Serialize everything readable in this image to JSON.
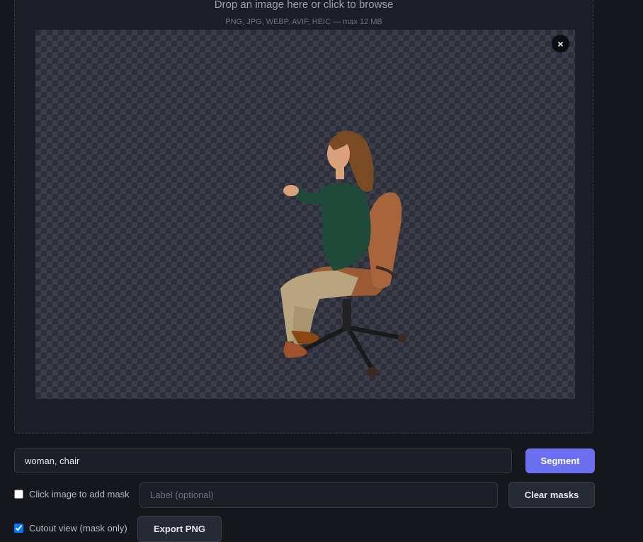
{
  "dropzone": {
    "title": "Drop an image here or click to browse",
    "hint": "PNG, JPG, WEBP, AVIF, HEIC — max 12 MB"
  },
  "preview": {
    "close_icon": "×",
    "image_subject": "woman-sitting-in-office-chair-cutout"
  },
  "prompt": {
    "value": "woman, chair"
  },
  "segment_label": "Segment",
  "click_mask": {
    "label": "Click image to add mask",
    "checked": false
  },
  "mask_label": {
    "placeholder": "Label (optional)"
  },
  "clear_label": "Clear masks",
  "cutout_view": {
    "label": "Cutout view (mask only)",
    "checked": true
  },
  "export_label": "Export PNG",
  "colors": {
    "accent": "#6b6ff0",
    "background": "#15171d",
    "panel": "#1c1f27"
  }
}
